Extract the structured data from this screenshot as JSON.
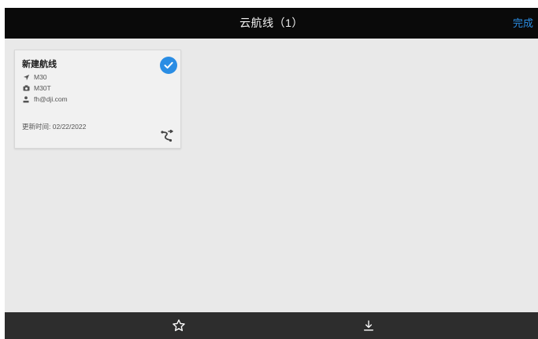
{
  "header": {
    "title": "云航线（1）",
    "done_label": "完成"
  },
  "routes": [
    {
      "name": "新建航线",
      "aircraft": "M30",
      "camera": "M30T",
      "user": "fh@dji.com",
      "updated_label": "更新时间:",
      "updated_value": "02/22/2022",
      "selected": true,
      "icons": {
        "selected": "check-circle-icon",
        "aircraft": "drone-icon",
        "camera": "camera-icon",
        "user": "user-icon",
        "route": "waypoint-route-icon"
      }
    }
  ],
  "bottom_toolbar": {
    "icons": [
      "star-outline-icon",
      "download-icon"
    ]
  },
  "colors": {
    "topbar_bg": "#0a0a0a",
    "content_bg": "#e9e9e9",
    "bottombar_bg": "#2d2d2d",
    "accent": "#2a8de4"
  }
}
